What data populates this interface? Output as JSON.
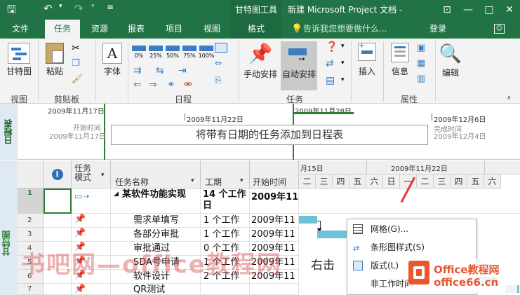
{
  "titlebar": {
    "context_title": "甘特图工具",
    "doc_title": "新建 Microsoft Project 文档 -",
    "minimize": "—",
    "maximize": "□",
    "close": "✕"
  },
  "tabs": [
    "文件",
    "任务",
    "资源",
    "报表",
    "项目",
    "视图"
  ],
  "context_tab": "格式",
  "tell_me": "告诉我您想要做什么...",
  "login": "登录",
  "ribbon": {
    "gantt_label": "甘特图",
    "paste_label": "粘贴",
    "font_label": "字体",
    "percent_labels": [
      "0%",
      "25%",
      "50%",
      "75%",
      "100%"
    ],
    "manual_label": "手动安排",
    "auto_label": "自动安排",
    "insert_label": "插入",
    "info_label": "信息",
    "edit_label": "编辑",
    "groups": {
      "view": "视图",
      "clipboard": "剪贴板",
      "schedule": "日程",
      "tasks": "任务",
      "properties": "属性"
    }
  },
  "timeline": {
    "label": "日程表",
    "start_date": "2009年11月17日",
    "start_sub_label": "开始时间",
    "start_sub_date": "2009年11月17日",
    "tick1": "2009年11月22日",
    "tick2": "2009年11月28日",
    "end_date": "2009年12月6日",
    "end_sub_label": "完成时间",
    "end_sub_date": "2009年12月4日",
    "placeholder": "将带有日期的任务添加到日程表"
  },
  "grid": {
    "view_label": "甘特图",
    "headers": {
      "mode": "任务模式",
      "name": "任务名称",
      "duration": "工期",
      "start": "开始时间"
    },
    "rows": [
      {
        "num": "1",
        "name": "某软件功能实现",
        "duration": "14 个工作日",
        "start": "2009年11"
      },
      {
        "num": "2",
        "name": "需求单填写",
        "duration": "1 个工作",
        "start": "2009年11"
      },
      {
        "num": "3",
        "name": "各部分审批",
        "duration": "1 个工作",
        "start": "2009年11"
      },
      {
        "num": "4",
        "name": "审批通过",
        "duration": "0 个工作",
        "start": "2009年11"
      },
      {
        "num": "5",
        "name": "SDA号申请",
        "duration": "1 个工作",
        "start": "2009年11"
      },
      {
        "num": "6",
        "name": "软件设计",
        "duration": "2 个工作",
        "start": "2009年11"
      },
      {
        "num": "7",
        "name": "QR测试",
        "duration": "",
        "start": ""
      }
    ]
  },
  "gantt": {
    "week1": "月15日",
    "week2": "2009年11月22日",
    "days": [
      "二",
      "三",
      "四",
      "五",
      "六",
      "日",
      "一",
      "二",
      "三",
      "四",
      "五",
      "六"
    ]
  },
  "context_menu": {
    "items": [
      "网格(G)...",
      "条形图样式(S)",
      "版式(L)",
      "非工作时间"
    ]
  },
  "watermarks": {
    "left": "书吧网—office教程网",
    "right_click": "右击",
    "logo": "Office教程网",
    "logo_url": "office66.cn"
  },
  "colors": {
    "brand": "#217346",
    "pin": "#3ea3c7",
    "bar": "#6cc3d5",
    "logo": "#e8572e"
  }
}
